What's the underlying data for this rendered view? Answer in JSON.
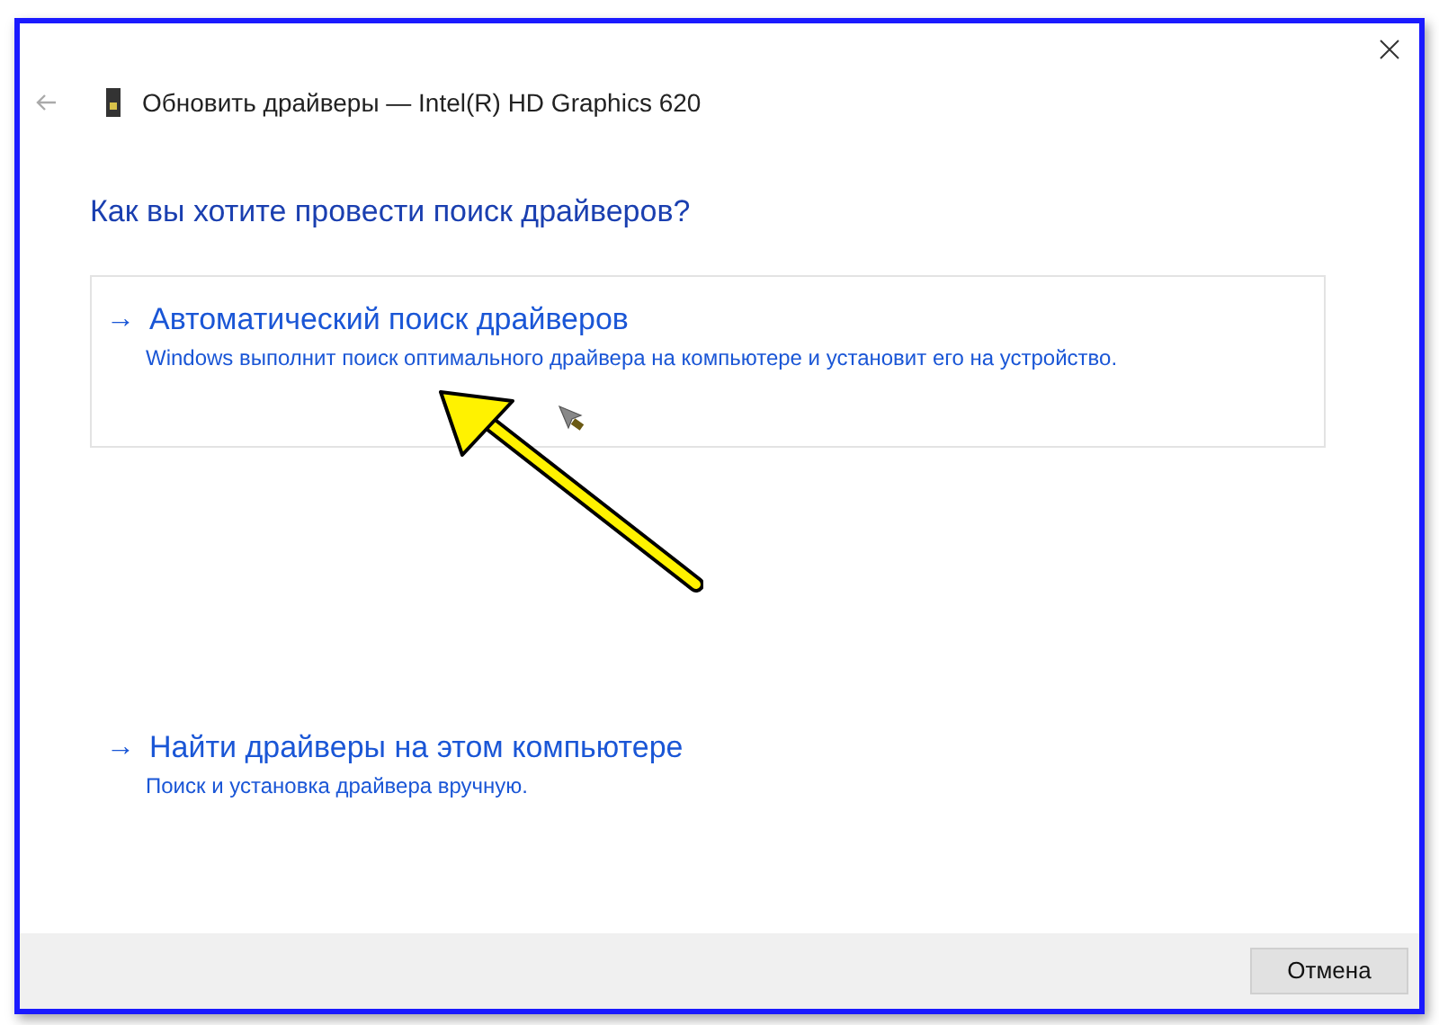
{
  "window": {
    "title": "Обновить драйверы — Intel(R) HD Graphics 620"
  },
  "heading": "Как вы хотите провести поиск драйверов?",
  "options": [
    {
      "arrow": "→",
      "title": "Автоматический поиск драйверов",
      "description": "Windows выполнит поиск оптимального драйвера на компьютере и установит его на устройство.",
      "hovered": true
    },
    {
      "arrow": "→",
      "title": "Найти драйверы на этом компьютере",
      "description": "Поиск и установка драйвера вручную.",
      "hovered": false
    }
  ],
  "buttons": [
    "Отмена"
  ]
}
